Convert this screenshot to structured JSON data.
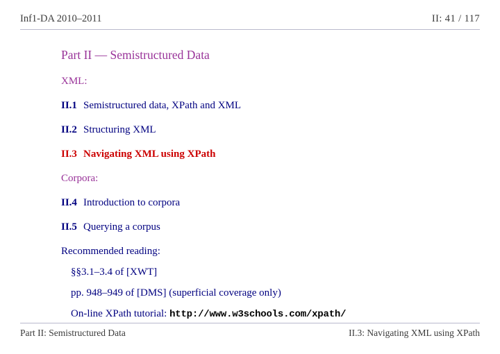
{
  "header": {
    "course": "Inf1-DA 2010–2011",
    "page_indicator": "II: 41  /  117"
  },
  "slide": {
    "title": "Part II — Semistructured Data",
    "groups": [
      {
        "label": "XML:",
        "entries": [
          {
            "num": "II.1",
            "text": "Semistructured data, XPath and XML",
            "current": false
          },
          {
            "num": "II.2",
            "text": "Structuring XML",
            "current": false
          },
          {
            "num": "II.3",
            "text": "Navigating XML using XPath",
            "current": true
          }
        ]
      },
      {
        "label": "Corpora:",
        "entries": [
          {
            "num": "II.4",
            "text": "Introduction to corpora",
            "current": false
          },
          {
            "num": "II.5",
            "text": "Querying a corpus",
            "current": false
          }
        ]
      }
    ],
    "reading": {
      "heading": "Recommended reading:",
      "items": [
        "§§3.1–3.4 of [XWT]",
        "pp. 948–949 of [DMS] (superficial coverage only)"
      ],
      "tutorial_label": "On-line XPath tutorial:",
      "tutorial_url": "http://www.w3schools.com/xpath/"
    }
  },
  "footer": {
    "left": "Part II: Semistructured Data",
    "right": "II.3: Navigating XML using XPath"
  },
  "colors": {
    "title_purple": "#993399",
    "entry_blue": "#000080",
    "current_red": "#cc0000",
    "rule_gray": "#b9b9cc",
    "chrome_text": "#3b3b3b"
  }
}
